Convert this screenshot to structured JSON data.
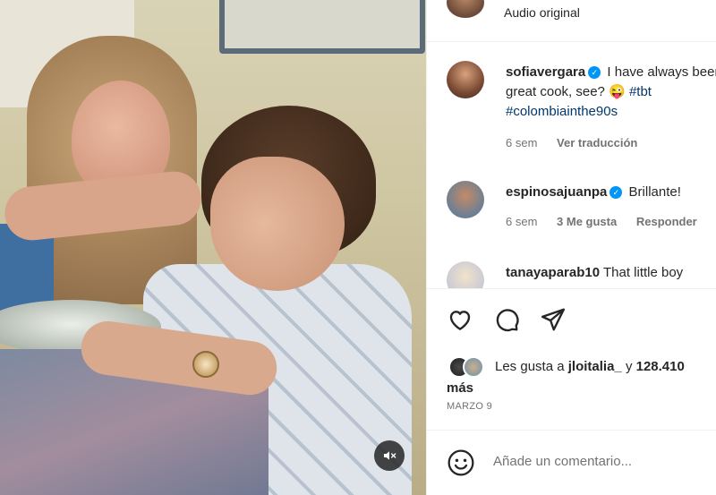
{
  "video": {
    "mute_icon": "speaker-muted-icon"
  },
  "header": {
    "audio_label": "Audio original"
  },
  "comments": [
    {
      "username": "sofiavergara",
      "verified": true,
      "text": "I have always been a great cook, see?",
      "emoji": "😜",
      "hashtags": [
        "#tbt",
        "#colombiainthe90s"
      ],
      "time": "6 sem",
      "action": "Ver traducción"
    },
    {
      "username": "espinosajuanpa",
      "verified": true,
      "text": "Brillante!",
      "time": "6 sem",
      "likes": "3 Me gusta",
      "action": "Responder"
    },
    {
      "username": "tanayaparab10",
      "text": "That little boy"
    }
  ],
  "actions": {
    "like_icon": "heart-icon",
    "comment_icon": "comment-icon",
    "share_icon": "send-icon"
  },
  "likes": {
    "prefix": "Les gusta a",
    "user": "jloitalia_",
    "joiner": "y",
    "count": "128.410",
    "more": "más"
  },
  "date": "MARZO 9",
  "composer": {
    "emoji_icon": "smiley-icon",
    "placeholder": "Añade un comentario..."
  }
}
